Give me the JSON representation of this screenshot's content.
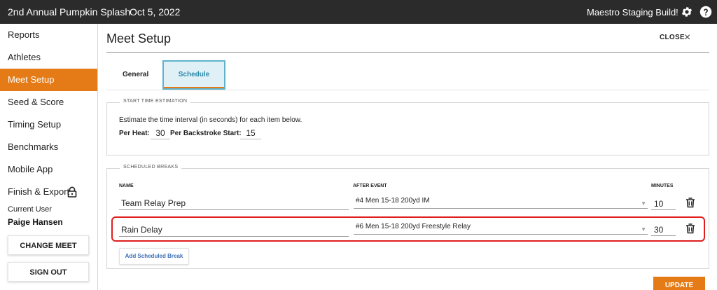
{
  "topbar": {
    "meet_name": "2nd Annual Pumpkin Splash",
    "meet_date": "Oct 5, 2022",
    "build_label": "Maestro Staging Build!",
    "settings_icon": "gear-icon",
    "help_icon": "help-icon"
  },
  "sidebar": {
    "items": [
      {
        "label": "Reports",
        "active": false
      },
      {
        "label": "Athletes",
        "active": false
      },
      {
        "label": "Meet Setup",
        "active": true
      },
      {
        "label": "Seed & Score",
        "active": false
      },
      {
        "label": "Timing Setup",
        "active": false
      },
      {
        "label": "Benchmarks",
        "active": false
      },
      {
        "label": "Mobile App",
        "active": false
      },
      {
        "label": "Finish & Export",
        "active": false,
        "icon": "lock-icon"
      }
    ],
    "current_user_label": "Current User",
    "current_user_name": "Paige Hansen",
    "change_meet_label": "CHANGE MEET",
    "sign_out_label": "SIGN OUT"
  },
  "main": {
    "title": "Meet Setup",
    "close_label": "CLOSE",
    "close_icon": "×",
    "tabs": [
      {
        "label": "General",
        "selected": false
      },
      {
        "label": "Schedule",
        "selected": true
      }
    ],
    "start_time": {
      "legend": "START TIME ESTIMATION",
      "description": "Estimate the time interval (in seconds) for each item below.",
      "per_heat_label": "Per Heat:",
      "per_heat_value": "30",
      "per_backstroke_label": "Per Backstroke Start:",
      "per_backstroke_value": "15"
    },
    "breaks": {
      "legend": "SCHEDULED BREAKS",
      "col_name": "NAME",
      "col_after_event": "AFTER EVENT",
      "col_minutes": "MINUTES",
      "rows": [
        {
          "name": "Team Relay Prep",
          "after_event": "#4 Men 15-18 200yd IM",
          "minutes": "10"
        },
        {
          "name": "Rain Delay",
          "after_event": "#6 Men 15-18 200yd Freestyle Relay",
          "minutes": "30"
        }
      ],
      "add_label": "Add Scheduled Break"
    },
    "update_label": "UPDATE"
  },
  "colors": {
    "accent": "#e47b16",
    "topbar_bg": "#2b2b2b",
    "tab_selected_bg": "#dff0f6",
    "tab_selected_border": "#5fb3cc",
    "highlight": "#e01e1e",
    "link_blue": "#3e6fb5"
  }
}
